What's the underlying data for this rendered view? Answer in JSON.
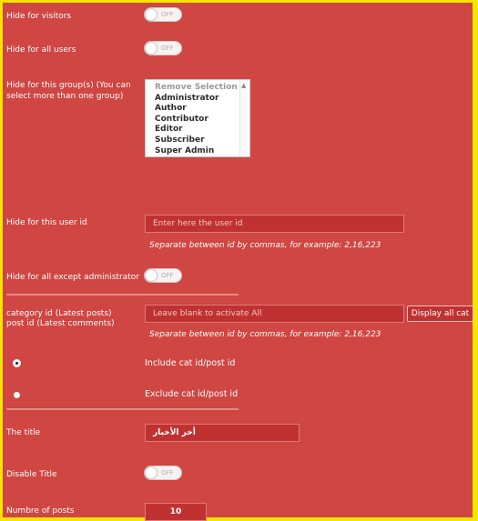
{
  "labels": {
    "hide_visitors": "Hide for visitors",
    "hide_all_users": "Hide for all users",
    "hide_groups": "Hide for this group(s) (You can select more than one group)",
    "hide_user_id": "Hide for this user id",
    "hide_except_admin": "Hide for all except administrator",
    "category_id": "category id (Latest posts)",
    "post_id": "post id (Latest comments)",
    "the_title": "The title",
    "disable_title": "Disable Title",
    "number_of_posts": "Numbre of posts"
  },
  "toggles": {
    "hide_visitors": "OFF",
    "hide_all_users": "OFF",
    "hide_except_admin": "OFF",
    "disable_title": "OFF"
  },
  "groups": {
    "options": [
      "Remove Selection",
      "Administrator",
      "Author",
      "Contributor",
      "Editor",
      "Subscriber",
      "Super Admin"
    ]
  },
  "user_id": {
    "placeholder": "Enter here the user id",
    "hint": "Separate between id by commas, for example: 2,16,223"
  },
  "cat_post": {
    "placeholder": "Leave blank to activate All",
    "hint": "Separate between id by commas, for example: 2,16,223",
    "display_all_button": "Display all cat",
    "include_label": "Include cat id/post id",
    "exclude_label": "Exclude cat id/post id",
    "selected": "include"
  },
  "title": {
    "value": "أخر الأخبار"
  },
  "posts": {
    "value": "10"
  },
  "colors": {
    "panel_bg": "#cf4642",
    "frame": "#f4e600",
    "input_bg": "#c03231"
  }
}
